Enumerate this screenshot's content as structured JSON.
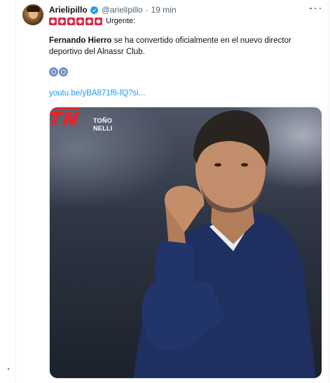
{
  "tweet": {
    "display_name": "Arielipillo",
    "handle": "@arielipillo",
    "separator": "·",
    "time": "19 min",
    "flag_count": 6,
    "flags_text": "Urgente:",
    "body_bold": "Fernando Hierro",
    "body_rest": " se ha convertido oficialmente en el nuevo director deportivo del Alnassr Club.",
    "emojis": [
      "globe-icon",
      "globe-icon"
    ],
    "link": "youtu.be/yBA871f6-fQ?si..."
  },
  "media": {
    "logo_text_line1": "TOÑO",
    "logo_text_line2": "NELLI"
  },
  "colors": {
    "accent": "#1d9bf0",
    "secondary_text": "#536471",
    "flag": "#d2314a",
    "logo_red": "#e0272e",
    "jacket": "#1f2f60"
  }
}
